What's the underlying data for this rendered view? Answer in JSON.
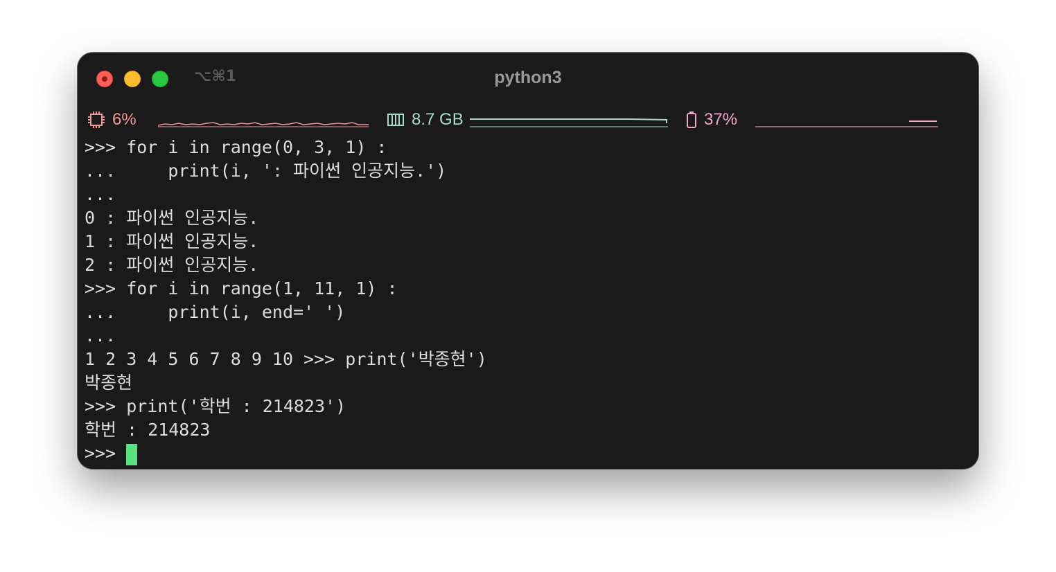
{
  "window": {
    "shortcut": "⌥⌘1",
    "title": "python3"
  },
  "statusbar": {
    "cpu": {
      "icon": "cpu-icon",
      "value": "6%",
      "color": "#ef9797"
    },
    "memory": {
      "icon": "memory-icon",
      "value": "8.7 GB",
      "color": "#a6dccb"
    },
    "battery": {
      "icon": "battery-icon",
      "value": "37%",
      "color": "#f4a6c9"
    }
  },
  "terminal": {
    "lines": [
      ">>> for i in range(0, 3, 1) :",
      "...     print(i, ': 파이썬 인공지능.')",
      "...",
      "0 : 파이썬 인공지능.",
      "1 : 파이썬 인공지능.",
      "2 : 파이썬 인공지능.",
      ">>> for i in range(1, 11, 1) :",
      "...     print(i, end=' ')",
      "...",
      "1 2 3 4 5 6 7 8 9 10 >>> print('박종현')",
      "박종현",
      ">>> print('학번 : 214823')",
      "학번 : 214823"
    ],
    "prompt": ">>> ",
    "cursor_color": "#59e07f"
  }
}
